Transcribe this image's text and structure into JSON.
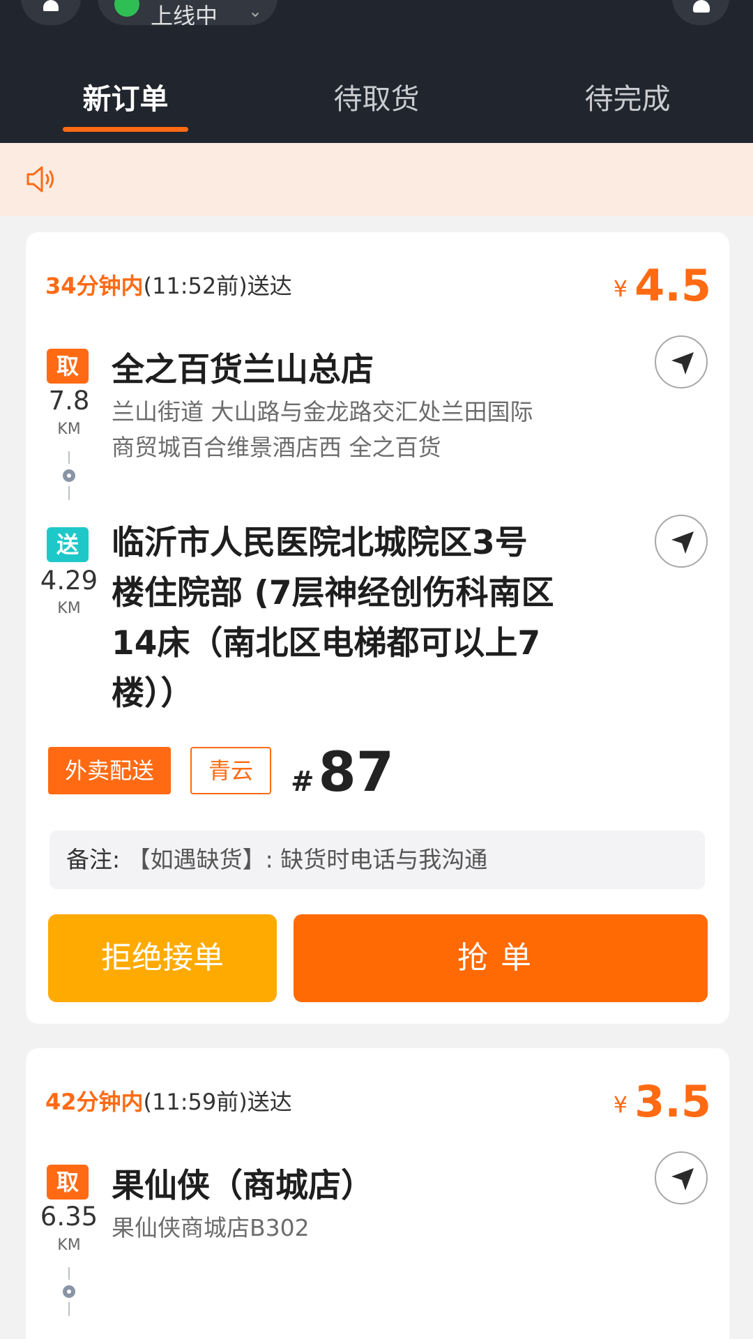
{
  "header": {
    "status": "上线中",
    "tabs": [
      "新订单",
      "待取货",
      "待完成"
    ],
    "active_tab": 0
  },
  "orders": [
    {
      "deadline_highlight": "34分钟内",
      "deadline_rest": "(11:52前)送达",
      "currency": "¥",
      "price": "4.5",
      "pickup": {
        "badge": "取",
        "distance": "7.8",
        "unit": "KM",
        "name": "全之百货兰山总店",
        "address_line1": "兰山街道 大山路与金龙路交汇处兰田国际",
        "address_line2": "商贸城百合维景酒店西 全之百货"
      },
      "dropoff": {
        "badge": "送",
        "distance": "4.29",
        "unit": "KM",
        "lines": [
          "临沂市人民医院北城院区3号",
          "楼住院部 (7层神经创伤科南区",
          "14床（南北区电梯都可以上7",
          "楼））"
        ]
      },
      "tag_type": "外卖配送",
      "tag_source": "青云",
      "order_hash": "#",
      "order_number": "87",
      "note_label": "备注:",
      "note_text": "【如遇缺货】: 缺货时电话与我沟通",
      "reject_label": "拒绝接单",
      "grab_label": "抢单"
    },
    {
      "deadline_highlight": "42分钟内",
      "deadline_rest": "(11:59前)送达",
      "currency": "¥",
      "price": "3.5",
      "pickup": {
        "badge": "取",
        "distance": "6.35",
        "unit": "KM",
        "name": "果仙侠（商城店）",
        "address_line1": "果仙侠商城店B302"
      }
    }
  ],
  "colors": {
    "header_bg": "#21252d",
    "accent": "#ff6a13",
    "reject_btn": "#ffaa00",
    "notice_bg": "#fbebe0",
    "dropoff_badge": "#1ec8c8"
  },
  "icons": [
    "user-icon",
    "online-status-icon",
    "bell-icon",
    "speaker-icon",
    "navigate-icon",
    "location-pin-icon"
  ]
}
